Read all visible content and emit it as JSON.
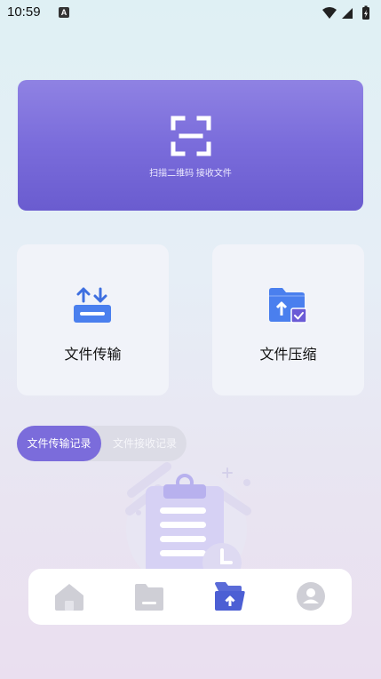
{
  "status_bar": {
    "time": "10:59",
    "indicator_letter": "A",
    "icons": [
      "wifi-icon",
      "signal-icon",
      "battery-charging-icon"
    ]
  },
  "scan": {
    "label": "扫描二维码 接收文件",
    "icon": "scan-qr-icon"
  },
  "features": [
    {
      "label": "文件传输",
      "icon": "transfer-icon"
    },
    {
      "label": "文件压缩",
      "icon": "compress-folder-icon"
    }
  ],
  "record_tabs": {
    "active": "文件传输记录",
    "inactive": "文件接收记录"
  },
  "bottom_nav": {
    "items": [
      "home-icon",
      "folder-icon",
      "folder-upload-icon",
      "profile-icon"
    ],
    "active_index": 2
  },
  "colors": {
    "accent": "#7b6cdb",
    "icon_blue": "#4a7fee",
    "nav_inactive": "#cfcfd6"
  }
}
